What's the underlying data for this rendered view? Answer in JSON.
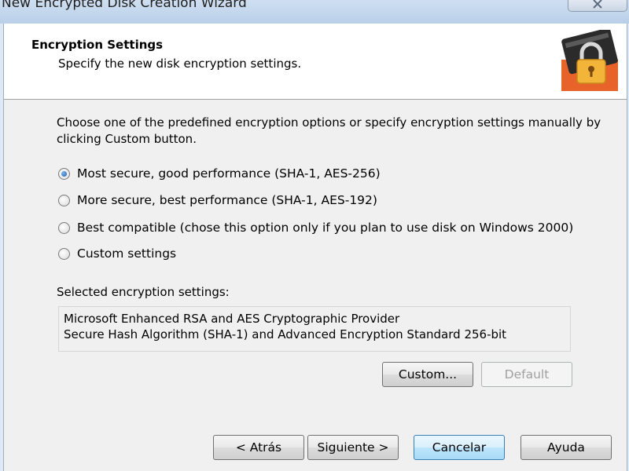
{
  "window": {
    "title": "New Encrypted Disk Creation Wizard"
  },
  "header": {
    "title": "Encryption Settings",
    "subtitle": "Specify the new disk encryption settings.",
    "icon": "lock-disk-icon"
  },
  "intro_text": "Choose one of the predefined encryption options or specify encryption settings manually by clicking Custom button.",
  "options": [
    {
      "label": "Most secure, good performance (SHA-1, AES-256)",
      "selected": true
    },
    {
      "label": "More secure, best performance (SHA-1, AES-192)",
      "selected": false
    },
    {
      "label": "Best compatible (chose this option only if you plan to use disk on Windows 2000)",
      "selected": false
    },
    {
      "label": "Custom settings",
      "selected": false
    }
  ],
  "selected_settings": {
    "label": "Selected encryption settings:",
    "lines": [
      "Microsoft Enhanced RSA and AES Cryptographic Provider",
      "Secure Hash Algorithm (SHA-1) and Advanced Encryption Standard 256-bit"
    ]
  },
  "buttons": {
    "custom": "Custom...",
    "default": "Default",
    "back": "< Atrás",
    "next": "Siguiente >",
    "cancel": "Cancelar",
    "help": "Ayuda"
  },
  "colors": {
    "accent": "#3c7fb1",
    "icon_orange": "#e8632a"
  }
}
